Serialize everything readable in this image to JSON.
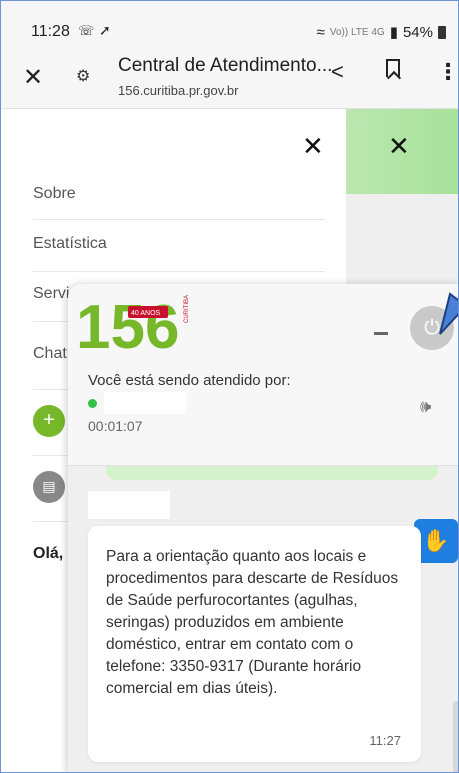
{
  "status_bar": {
    "time": "11:28",
    "whatsapp_icon": "whatsapp-icon",
    "network": "Vo)) LTE 4G",
    "battery": "54%"
  },
  "toolbar": {
    "title": "Central de Atendimento...",
    "url": "156.curitiba.pr.gov.br"
  },
  "menu": {
    "items": [
      "Sobre",
      "Estatística",
      "Servi",
      "Chat"
    ],
    "greeting": "Olá,"
  },
  "chat": {
    "logo": {
      "number": "156",
      "badge": "40 ANOS",
      "city": "CURITIBA"
    },
    "attended_label": "Você está sendo atendido por:",
    "timer": "00:01:07",
    "colors": {
      "logo_green": "#76b82a",
      "logo_red": "#c8102e",
      "libras_blue": "#1f7fe0"
    },
    "message": {
      "text": "Para a orientação quanto aos locais e procedimentos para descarte de Resíduos de Saúde perfurocortantes (agulhas, seringas) produzidos em ambiente doméstico, entrar em contato com o telefone: 3350-9317 (Durante horário comercial em dias úteis).",
      "time": "11:27"
    }
  }
}
